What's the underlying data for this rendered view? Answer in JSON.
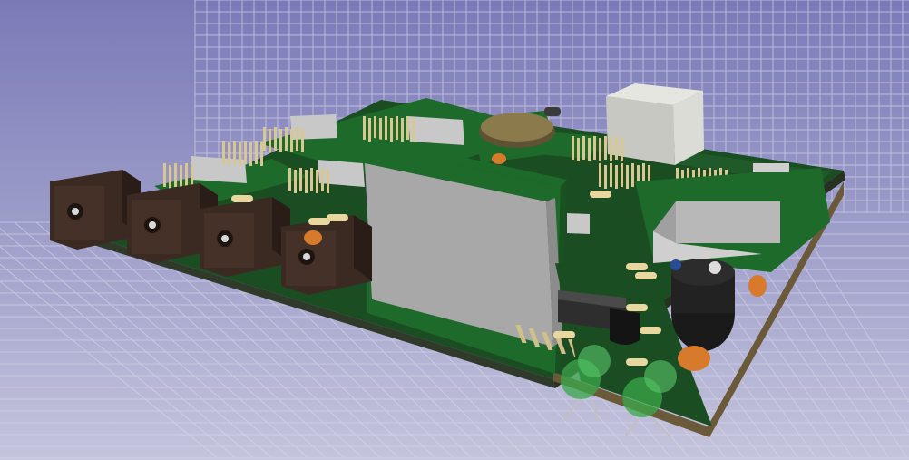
{
  "view": {
    "kind": "3D PCB render",
    "background_top": "#7a7ab8",
    "background_bottom": "#c4c4dc",
    "grid_color": "#d8d8ec",
    "board_color": "#1f5a26",
    "board_edge_color": "#2f3a2a",
    "module_board_color": "#1e6a2a"
  },
  "components": [
    {
      "name": "dc-jack-1",
      "type": "DC barrel jack"
    },
    {
      "name": "dc-jack-2",
      "type": "DC barrel jack"
    },
    {
      "name": "dc-jack-3",
      "type": "DC barrel jack"
    },
    {
      "name": "dc-jack-4",
      "type": "DC barrel jack"
    },
    {
      "name": "lcd-module",
      "type": "display module"
    },
    {
      "name": "relay",
      "type": "relay block"
    },
    {
      "name": "coin-cell",
      "type": "battery holder"
    },
    {
      "name": "wifi-module",
      "type": "RF module"
    },
    {
      "name": "buzzer",
      "type": "buzzer"
    },
    {
      "name": "led-1",
      "type": "green LED"
    },
    {
      "name": "led-2",
      "type": "green LED"
    },
    {
      "name": "dip-ic",
      "type": "DIP IC"
    },
    {
      "name": "transistor",
      "type": "TO-92"
    }
  ]
}
